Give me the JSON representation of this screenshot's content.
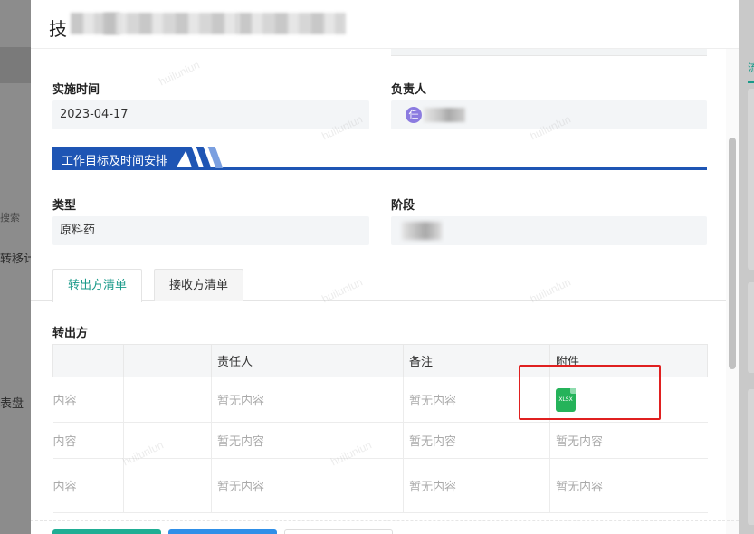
{
  "background": {
    "labels": [
      "搜索",
      "转移计",
      "表盘"
    ],
    "right_tab": "流"
  },
  "dialog": {
    "title_char": "技"
  },
  "form": {
    "impl_time_label": "实施时间",
    "impl_time_value": "2023-04-17",
    "owner_label": "负责人",
    "owner_avatar": "任",
    "section_title": "工作目标及时间安排",
    "type_label": "类型",
    "type_value": "原料药",
    "stage_label": "阶段"
  },
  "tabs": [
    {
      "label": "转出方清单",
      "active": true
    },
    {
      "label": "接收方清单",
      "active": false
    }
  ],
  "transfer_out": {
    "title": "转出方",
    "columns": [
      "",
      "",
      "责任人",
      "备注",
      "附件"
    ],
    "rows": [
      {
        "c0": "内容",
        "c2": "暂无内容",
        "c3": "暂无内容",
        "attachment": "XLSX"
      },
      {
        "c0": "内容",
        "c2": "暂无内容",
        "c3": "暂无内容",
        "c4": "暂无内容"
      },
      {
        "c0": "内容",
        "c2": "暂无内容",
        "c3": "暂无内容",
        "c4": "暂无内容"
      }
    ]
  },
  "watermark": "huilunlun",
  "colors": {
    "accent": "#1a9a8a",
    "banner": "#1e55b4",
    "highlight": "#e02020",
    "xlsx": "#25b35a"
  }
}
